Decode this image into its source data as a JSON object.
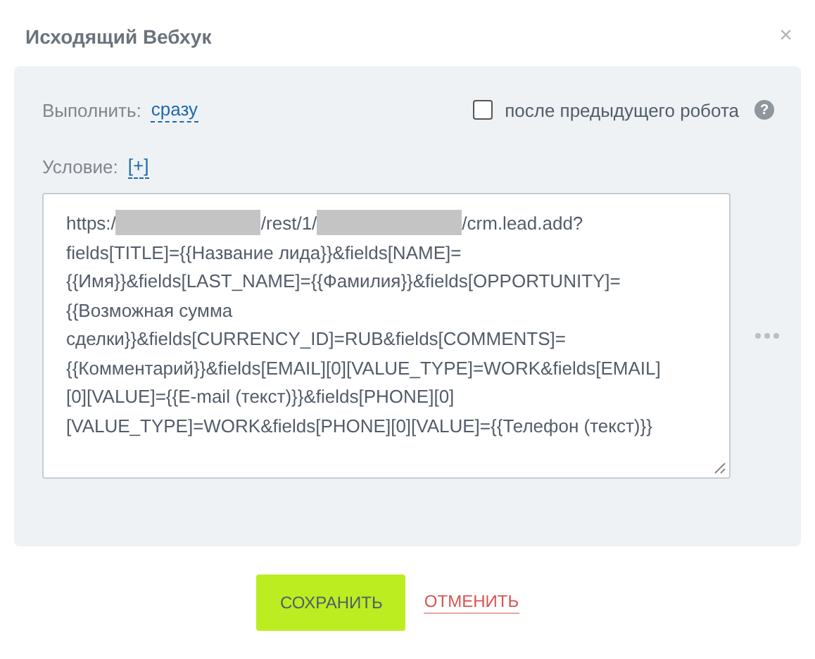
{
  "dialog": {
    "title": "Исходящий Вебхук",
    "close": "×"
  },
  "run": {
    "label": "Выполнить:",
    "value": "сразу"
  },
  "after_previous": {
    "label": "после предыдущего робота",
    "checked": false,
    "help": "?"
  },
  "condition": {
    "label": "Условие:",
    "value": "[+]"
  },
  "url": {
    "first_line": [
      "https:/",
      "/rest/1/",
      "/crm.lead.add?"
    ],
    "lines": [
      "fields[TITLE]={{Название лида}}&fields[NAME]=",
      "{{Имя}}&fields[LAST_NAME]={{Фамилия}}&fields[OPPORTUNITY]=",
      "{{Возможная сумма",
      "сделки}}&fields[CURRENCY_ID]=RUB&fields[COMMENTS]=",
      "{{Комментарий}}&fields[EMAIL][0][VALUE_TYPE]=WORK&fields[EMAIL]",
      "[0][VALUE]={{E-mail (текст)}}&fields[PHONE][0]",
      "[VALUE_TYPE]=WORK&fields[PHONE][0][VALUE]={{Телефон (текст)}}"
    ]
  },
  "buttons": {
    "save": "СОХРАНИТЬ",
    "cancel": "ОТМЕНИТЬ"
  }
}
